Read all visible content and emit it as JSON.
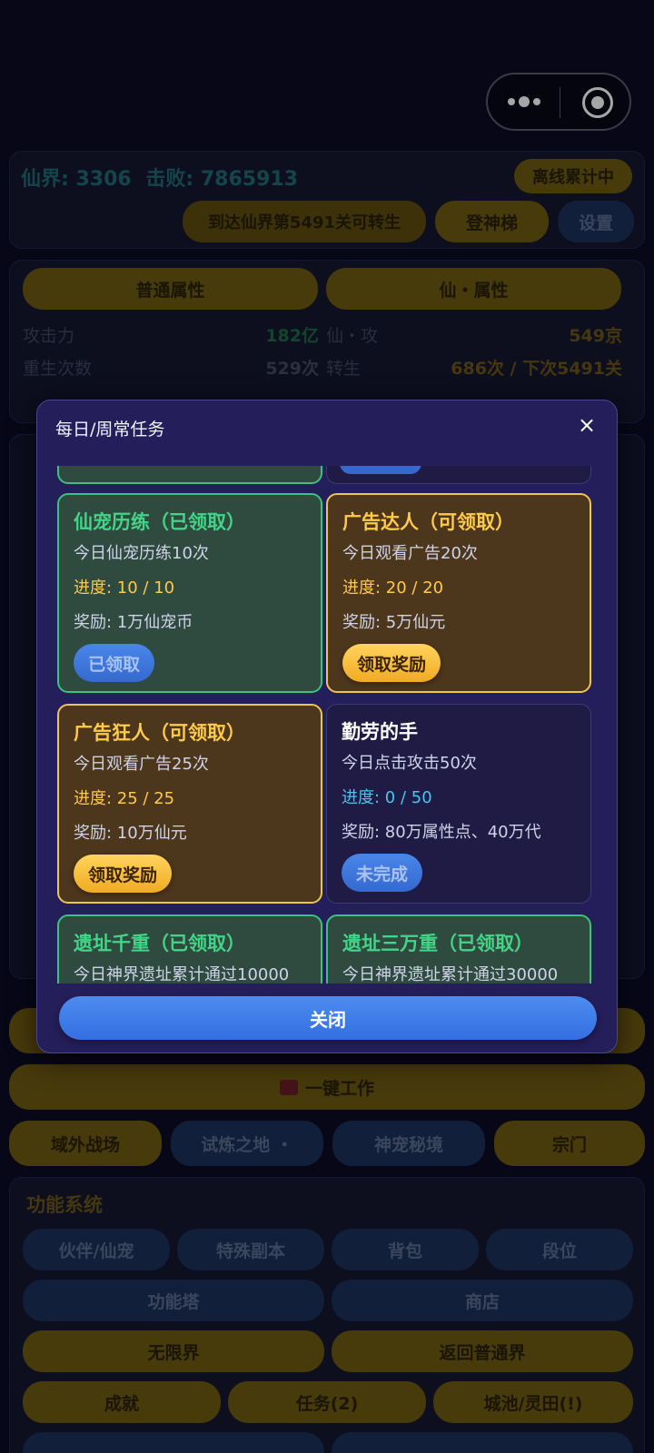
{
  "header": {
    "realm_label": "仙界:",
    "realm_value": "3306",
    "defeat_label": "击败:",
    "defeat_value": "7865913",
    "offline_badge": "离线累计中",
    "rebirth_hint": "到达仙界第5491关可转生",
    "ladder_button": "登神梯",
    "settings_button": "设置"
  },
  "attributes": {
    "tab_normal": "普通属性",
    "tab_immortal": "仙・属性",
    "rows": [
      {
        "label": "攻击力",
        "value": "182亿",
        "label2": "仙・攻",
        "value2": "549京"
      },
      {
        "label": "重生次数",
        "value": "529次",
        "label2": "转生",
        "value2": "686次 / 下次5491关"
      }
    ]
  },
  "actions": {
    "one_click_work": "一键工作",
    "zones": [
      "域外战场",
      "试炼之地 ・",
      "神宠秘境",
      "宗门"
    ]
  },
  "functions": {
    "title": "功能系统",
    "row1": [
      "伙伴/仙宠",
      "特殊副本",
      "背包",
      "段位"
    ],
    "row2": [
      "功能塔",
      "商店"
    ],
    "row3": [
      "无限界",
      "返回普通界"
    ],
    "row4": [
      "成就",
      "任务(2)",
      "城池/灵田(!)"
    ]
  },
  "modal": {
    "title": "每日/周常任务",
    "close_icon": "×",
    "close_button": "关闭",
    "cards": [
      {
        "title": "仙宠历练（已领取）",
        "desc": "今日仙宠历练10次",
        "progress": "进度: 10 / 10",
        "reward": "奖励: 1万仙宠币",
        "button": "已领取",
        "state": "done"
      },
      {
        "title": "广告达人（可领取）",
        "desc": "今日观看广告20次",
        "progress": "进度: 20 / 20",
        "reward": "奖励: 5万仙元",
        "button": "领取奖励",
        "state": "claim"
      },
      {
        "title": "广告狂人（可领取）",
        "desc": "今日观看广告25次",
        "progress": "进度: 25 / 25",
        "reward": "奖励: 10万仙元",
        "button": "领取奖励",
        "state": "claim"
      },
      {
        "title": "勤劳的手",
        "desc": "今日点击攻击50次",
        "progress": "进度: 0 / 50",
        "reward": "奖励: 80万属性点、40万代",
        "button": "未完成",
        "state": "todo"
      },
      {
        "title": "遗址千重（已领取）",
        "desc": "今日神界遗址累计通过10000",
        "state": "done"
      },
      {
        "title": "遗址三万重（已领取）",
        "desc": "今日神界遗址累计通过30000",
        "state": "done"
      }
    ]
  }
}
